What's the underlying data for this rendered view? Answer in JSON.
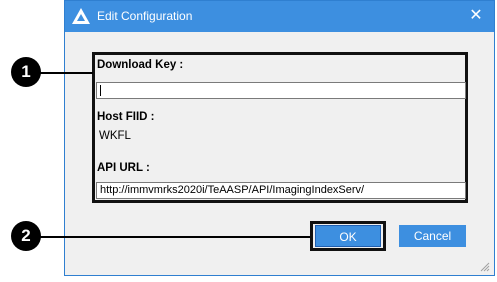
{
  "window": {
    "title": "Edit Configuration",
    "close_symbol": "✕",
    "app_icon": "triangle-logo-icon"
  },
  "fields": {
    "download_key": {
      "label": "Download Key :",
      "value": ""
    },
    "host_fiid": {
      "label": "Host FIID :",
      "value": "WKFL"
    },
    "api_url": {
      "label": "API URL :",
      "value": "http://immvmrks2020i/TeAASP/API/ImagingIndexServ/"
    }
  },
  "buttons": {
    "ok": "OK",
    "cancel": "Cancel"
  },
  "callouts": [
    {
      "number": "1"
    },
    {
      "number": "2"
    }
  ],
  "colors": {
    "accent": "#3d8fe0",
    "window_bg": "#f0f0f0",
    "highlight": "#111111"
  }
}
